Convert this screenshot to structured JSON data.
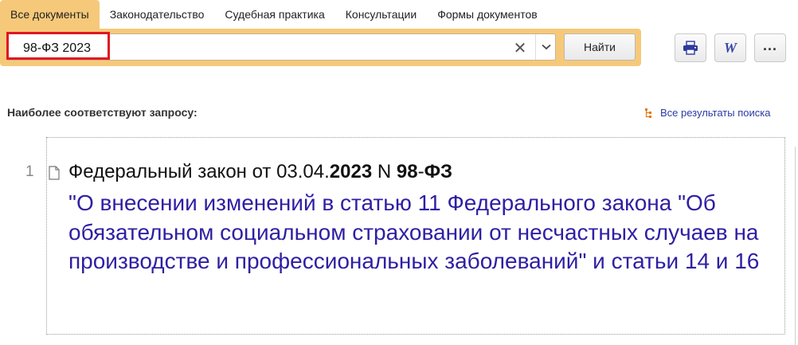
{
  "tabs": [
    {
      "label": "Все документы",
      "active": true
    },
    {
      "label": "Законодательство",
      "active": false
    },
    {
      "label": "Судебная практика",
      "active": false
    },
    {
      "label": "Консультации",
      "active": false
    },
    {
      "label": "Формы документов",
      "active": false
    }
  ],
  "search": {
    "query": "98-ФЗ 2023",
    "clear_icon": "✕",
    "dropdown_icon": "chevron-down-icon",
    "find_label": "Найти",
    "highlight_color": "#e0171f"
  },
  "toolbar": {
    "print_icon": "printer-icon",
    "word_label": "W",
    "more_label": "..."
  },
  "results": {
    "heading": "Наиболее соответствуют запросу:",
    "all_results_label": "Все результаты поиска",
    "items": [
      {
        "number": "1",
        "title_prefix": "Федеральный закон от 03.04.",
        "title_year": "2023",
        "title_mid": " N ",
        "title_num": "98",
        "title_dash": "-",
        "title_suffix": "ФЗ",
        "link": "\"О внесении изменений в статью 11 Федерального закона \"Об обязательном социальном страховании от несчастных случаев на производстве и профессиональных заболеваний\" и статьи 14 и 16"
      }
    ]
  },
  "colors": {
    "accent": "#f6c97a",
    "link": "#2e1fa3",
    "word_icon": "#3c47a8"
  }
}
